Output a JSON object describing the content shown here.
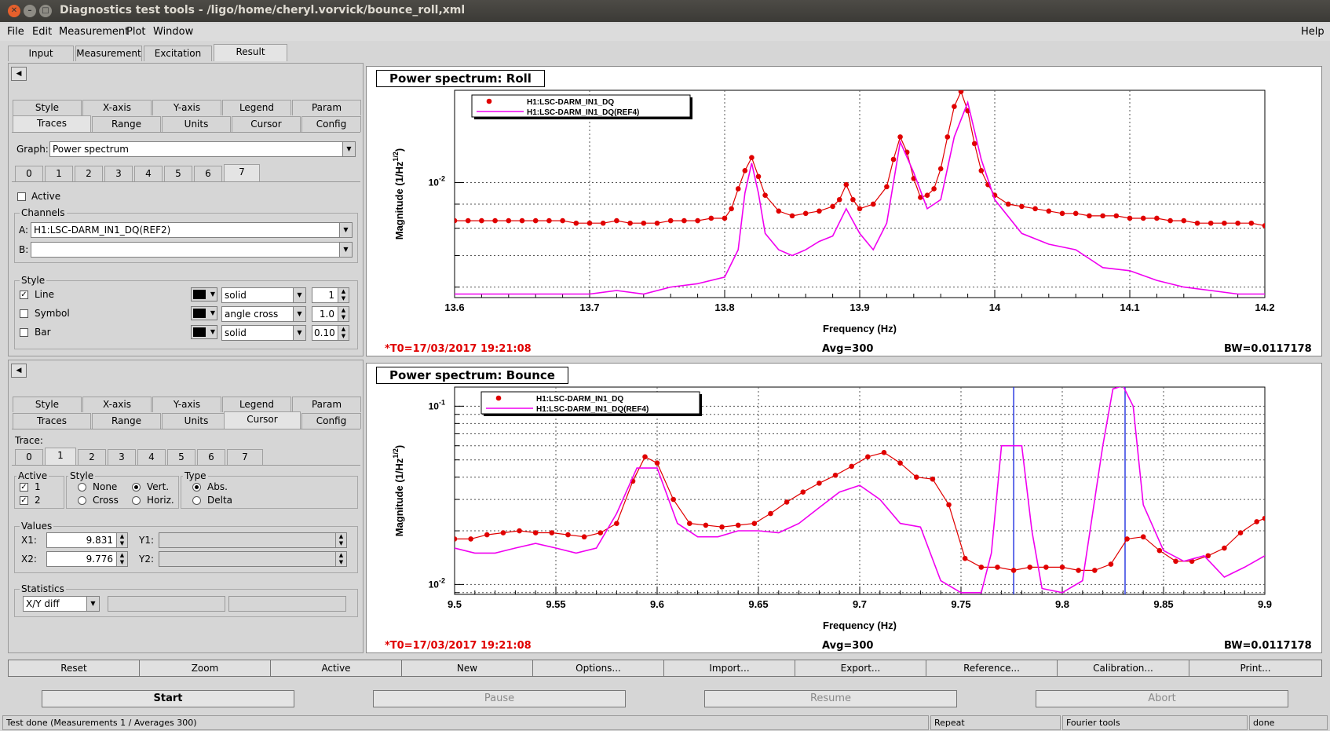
{
  "window": {
    "title": "Diagnostics test tools - /ligo/home/cheryl.vorvick/bounce_roll,xml"
  },
  "menu": {
    "items": [
      "File",
      "Edit",
      "Measurement",
      "Plot",
      "Window"
    ],
    "help": "Help"
  },
  "main_tabs": [
    "Input",
    "Measurement",
    "Excitation",
    "Result"
  ],
  "top_ctrl": {
    "tabs_row1": [
      "Style",
      "X-axis",
      "Y-axis",
      "Legend",
      "Param"
    ],
    "tabs_row2": [
      "Traces",
      "Range",
      "Units",
      "Cursor",
      "Config"
    ],
    "graph_label": "Graph:",
    "graph_value": "Power spectrum",
    "trace_tabs": [
      "0",
      "1",
      "2",
      "3",
      "4",
      "5",
      "6",
      "7"
    ],
    "active_label": "Active",
    "channels_title": "Channels",
    "a_label": "A:",
    "a_value": "H1:LSC-DARM_IN1_DQ(REF2)",
    "b_label": "B:",
    "b_value": "",
    "style_title": "Style",
    "line_label": "Line",
    "line_style": "solid",
    "line_width": "1",
    "symbol_label": "Symbol",
    "symbol_style": "angle cross",
    "symbol_size": "1.0",
    "bar_label": "Bar",
    "bar_style": "solid",
    "bar_width": "0.10"
  },
  "bot_ctrl": {
    "tabs_row1": [
      "Style",
      "X-axis",
      "Y-axis",
      "Legend",
      "Param"
    ],
    "tabs_row2": [
      "Traces",
      "Range",
      "Units",
      "Cursor",
      "Config"
    ],
    "trace_label": "Trace:",
    "trace_tabs": [
      "0",
      "1",
      "2",
      "3",
      "4",
      "5",
      "6",
      "7"
    ],
    "active_title": "Active",
    "active1": "1",
    "active2": "2",
    "style_title": "Style",
    "none": "None",
    "vert": "Vert.",
    "cross": "Cross",
    "horiz": "Horiz.",
    "type_title": "Type",
    "abs": "Abs.",
    "delta": "Delta",
    "values_title": "Values",
    "x1_label": "X1:",
    "x1": "9.831",
    "y1_label": "Y1:",
    "x2_label": "X2:",
    "x2": "9.776",
    "y2_label": "Y2:",
    "stats_title": "Statistics",
    "stats_value": "X/Y diff"
  },
  "graph1": {
    "title": "Power spectrum: Roll",
    "t0": "*T0=17/03/2017 19:21:08",
    "avg": "Avg=300",
    "bw": "BW=0.0117178"
  },
  "graph2": {
    "title": "Power spectrum: Bounce",
    "t0": "*T0=17/03/2017 19:21:08",
    "avg": "Avg=300",
    "bw": "BW=0.0117178"
  },
  "buttons": [
    "Reset",
    "Zoom",
    "Active",
    "New",
    "Options...",
    "Import...",
    "Export...",
    "Reference...",
    "Calibration...",
    "Print..."
  ],
  "control": {
    "start": "Start",
    "pause": "Pause",
    "resume": "Resume",
    "abort": "Abort"
  },
  "status": {
    "msg": "Test done (Measurements 1 / Averages 300)",
    "repeat": "Repeat",
    "fourier": "Fourier tools",
    "done": "done"
  },
  "colors": {
    "series_red": "#e00000",
    "series_magenta": "#f000f0",
    "cursor": "#2030e0"
  },
  "chart_data": [
    {
      "type": "line",
      "title": "Power spectrum: Roll",
      "xlabel": "Frequency (Hz)",
      "ylabel": "Magnitude (1/Hz^1/2)",
      "xlim": [
        13.6,
        14.2
      ],
      "ylim": [
        0.0057,
        0.0157
      ],
      "yscale": "log",
      "xticks": [
        "13.6",
        "13.7",
        "13.8",
        "13.9",
        "14",
        "14.1",
        "14.2"
      ],
      "yticks": [
        "10^-2"
      ],
      "legend": "top-left",
      "series": [
        {
          "name": "H1:LSC-DARM_IN1_DQ",
          "marker": "circle",
          "x": [
            13.6,
            13.61,
            13.62,
            13.63,
            13.64,
            13.65,
            13.66,
            13.67,
            13.68,
            13.69,
            13.7,
            13.71,
            13.72,
            13.73,
            13.74,
            13.75,
            13.76,
            13.77,
            13.78,
            13.79,
            13.8,
            13.805,
            13.81,
            13.815,
            13.82,
            13.825,
            13.83,
            13.84,
            13.85,
            13.86,
            13.87,
            13.88,
            13.885,
            13.89,
            13.895,
            13.9,
            13.91,
            13.92,
            13.925,
            13.93,
            13.935,
            13.94,
            13.945,
            13.95,
            13.955,
            13.96,
            13.965,
            13.97,
            13.975,
            13.98,
            13.985,
            13.99,
            13.995,
            14.0,
            14.01,
            14.02,
            14.03,
            14.04,
            14.05,
            14.06,
            14.07,
            14.08,
            14.09,
            14.1,
            14.11,
            14.12,
            14.13,
            14.14,
            14.15,
            14.16,
            14.17,
            14.18,
            14.19,
            14.2
          ],
          "y": [
            0.0083,
            0.0083,
            0.0083,
            0.0083,
            0.0083,
            0.0083,
            0.0083,
            0.0083,
            0.0083,
            0.0082,
            0.0082,
            0.0082,
            0.0083,
            0.0082,
            0.0082,
            0.0082,
            0.0083,
            0.0083,
            0.0083,
            0.0084,
            0.0084,
            0.0088,
            0.0097,
            0.0106,
            0.0113,
            0.0103,
            0.0094,
            0.0087,
            0.0085,
            0.0086,
            0.0087,
            0.0089,
            0.0092,
            0.0099,
            0.0092,
            0.0088,
            0.009,
            0.0098,
            0.0112,
            0.0125,
            0.0116,
            0.0102,
            0.0093,
            0.0094,
            0.0097,
            0.0107,
            0.0125,
            0.0145,
            0.0156,
            0.0142,
            0.0121,
            0.0106,
            0.0099,
            0.0094,
            0.009,
            0.0089,
            0.0088,
            0.0087,
            0.0086,
            0.0086,
            0.0085,
            0.0085,
            0.0085,
            0.0084,
            0.0084,
            0.0084,
            0.0083,
            0.0083,
            0.0082,
            0.0082,
            0.0082,
            0.0082,
            0.0082,
            0.0081
          ]
        },
        {
          "name": "H1:LSC-DARM_IN1_DQ(REF4)",
          "marker": "none",
          "x": [
            13.6,
            13.62,
            13.64,
            13.66,
            13.68,
            13.7,
            13.72,
            13.74,
            13.76,
            13.78,
            13.8,
            13.81,
            13.815,
            13.82,
            13.825,
            13.83,
            13.84,
            13.85,
            13.86,
            13.87,
            13.88,
            13.89,
            13.9,
            13.91,
            13.92,
            13.93,
            13.94,
            13.95,
            13.96,
            13.97,
            13.98,
            13.99,
            14.0,
            14.02,
            14.04,
            14.06,
            14.08,
            14.1,
            14.12,
            14.14,
            14.16,
            14.18,
            14.2
          ],
          "y": [
            0.0058,
            0.0058,
            0.0058,
            0.0058,
            0.0058,
            0.0058,
            0.0059,
            0.0058,
            0.006,
            0.0061,
            0.0063,
            0.0072,
            0.0095,
            0.011,
            0.0095,
            0.0078,
            0.0072,
            0.007,
            0.0072,
            0.0075,
            0.0077,
            0.0088,
            0.0078,
            0.0072,
            0.0082,
            0.0122,
            0.0105,
            0.0088,
            0.0092,
            0.0125,
            0.0148,
            0.0112,
            0.0092,
            0.0078,
            0.0074,
            0.0072,
            0.0066,
            0.0065,
            0.0062,
            0.006,
            0.0059,
            0.0058,
            0.0058
          ]
        }
      ]
    },
    {
      "type": "line",
      "title": "Power spectrum: Bounce",
      "xlabel": "Frequency (Hz)",
      "ylabel": "Magnitude (1/Hz^1/2)",
      "xlim": [
        9.5,
        9.9
      ],
      "ylim": [
        0.0088,
        0.128
      ],
      "yscale": "log",
      "xticks": [
        "9.5",
        "9.55",
        "9.6",
        "9.65",
        "9.7",
        "9.75",
        "9.8",
        "9.85",
        "9.9"
      ],
      "yticks": [
        "10^-1",
        "10^-2"
      ],
      "legend": "top-left",
      "cursors_x": [
        9.776,
        9.831
      ],
      "series": [
        {
          "name": "H1:LSC-DARM_IN1_DQ",
          "marker": "circle",
          "x": [
            9.5,
            9.508,
            9.516,
            9.524,
            9.532,
            9.54,
            9.548,
            9.556,
            9.564,
            9.572,
            9.58,
            9.588,
            9.594,
            9.6,
            9.608,
            9.616,
            9.624,
            9.632,
            9.64,
            9.648,
            9.656,
            9.664,
            9.672,
            9.68,
            9.688,
            9.696,
            9.704,
            9.712,
            9.72,
            9.728,
            9.736,
            9.744,
            9.752,
            9.76,
            9.768,
            9.776,
            9.784,
            9.792,
            9.8,
            9.808,
            9.816,
            9.824,
            9.832,
            9.84,
            9.848,
            9.856,
            9.864,
            9.872,
            9.88,
            9.888,
            9.896,
            9.9
          ],
          "y": [
            0.018,
            0.018,
            0.019,
            0.0195,
            0.02,
            0.0195,
            0.0195,
            0.019,
            0.0185,
            0.0195,
            0.022,
            0.038,
            0.052,
            0.048,
            0.03,
            0.022,
            0.0215,
            0.021,
            0.0215,
            0.022,
            0.025,
            0.029,
            0.033,
            0.037,
            0.041,
            0.046,
            0.052,
            0.055,
            0.048,
            0.04,
            0.039,
            0.028,
            0.014,
            0.0125,
            0.0125,
            0.012,
            0.0125,
            0.0125,
            0.0125,
            0.012,
            0.012,
            0.013,
            0.018,
            0.0185,
            0.0155,
            0.0135,
            0.0135,
            0.0145,
            0.016,
            0.0195,
            0.0225,
            0.0235
          ]
        },
        {
          "name": "H1:LSC-DARM_IN1_DQ(REF4)",
          "marker": "none",
          "x": [
            9.5,
            9.51,
            9.52,
            9.53,
            9.54,
            9.55,
            9.56,
            9.57,
            9.58,
            9.59,
            9.6,
            9.61,
            9.62,
            9.63,
            9.64,
            9.65,
            9.66,
            9.67,
            9.68,
            9.69,
            9.7,
            9.71,
            9.72,
            9.73,
            9.74,
            9.75,
            9.76,
            9.765,
            9.77,
            9.775,
            9.78,
            9.785,
            9.79,
            9.8,
            9.81,
            9.82,
            9.825,
            9.83,
            9.835,
            9.84,
            9.85,
            9.86,
            9.87,
            9.88,
            9.89,
            9.9
          ],
          "y": [
            0.016,
            0.015,
            0.015,
            0.016,
            0.017,
            0.016,
            0.015,
            0.016,
            0.025,
            0.045,
            0.045,
            0.022,
            0.0185,
            0.0185,
            0.02,
            0.02,
            0.0195,
            0.022,
            0.027,
            0.033,
            0.036,
            0.03,
            0.022,
            0.021,
            0.0105,
            0.009,
            0.009,
            0.015,
            0.06,
            0.06,
            0.06,
            0.02,
            0.0095,
            0.009,
            0.0105,
            0.06,
            0.125,
            0.13,
            0.1,
            0.028,
            0.0155,
            0.0135,
            0.0145,
            0.011,
            0.0125,
            0.0145
          ]
        }
      ]
    }
  ]
}
